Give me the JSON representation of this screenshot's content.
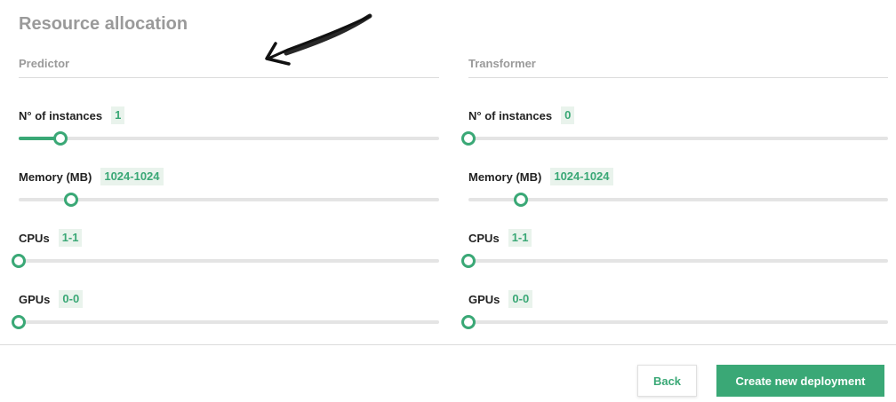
{
  "title": "Resource allocation",
  "accent_color": "#3aa876",
  "predictor": {
    "heading": "Predictor",
    "fields": [
      {
        "label": "N° of instances",
        "value": "1",
        "level": 0.1
      },
      {
        "label": "Memory (MB)",
        "value": "1024-1024",
        "level": 0.125
      },
      {
        "label": "CPUs",
        "value": "1-1",
        "level": 0
      },
      {
        "label": "GPUs",
        "value": "0-0",
        "level": 0
      }
    ]
  },
  "transformer": {
    "heading": "Transformer",
    "fields": [
      {
        "label": "N° of instances",
        "value": "0",
        "level": 0
      },
      {
        "label": "Memory (MB)",
        "value": "1024-1024",
        "level": 0.125
      },
      {
        "label": "CPUs",
        "value": "1-1",
        "level": 0
      },
      {
        "label": "GPUs",
        "value": "0-0",
        "level": 0
      }
    ]
  },
  "buttons": {
    "back": "Back",
    "create": "Create new deployment"
  }
}
